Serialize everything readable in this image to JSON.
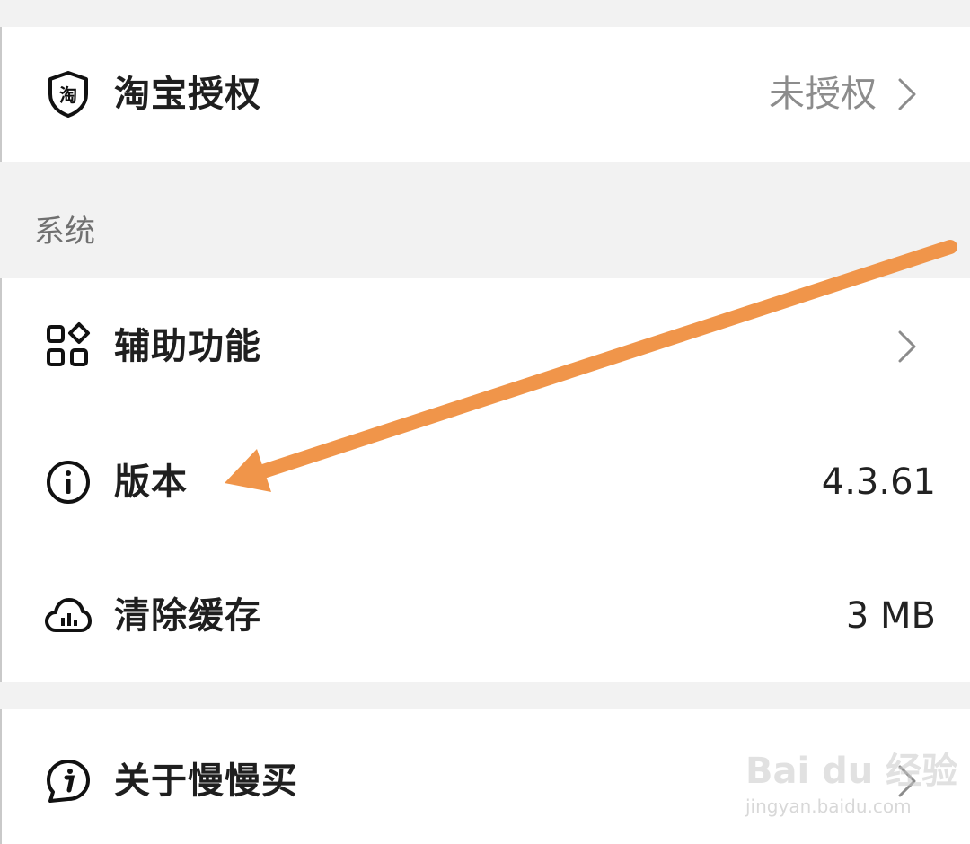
{
  "taobao_row": {
    "icon": "taobao-shield-icon",
    "icon_text": "淘",
    "label": "淘宝授权",
    "value": "未授权"
  },
  "system_section": {
    "header": "系统",
    "items": [
      {
        "icon": "apps-grid-icon",
        "label": "辅助功能",
        "value": ""
      },
      {
        "icon": "info-circle-icon",
        "label": "版本",
        "value": "4.3.61"
      },
      {
        "icon": "cloud-icon",
        "label": "清除缓存",
        "value": "3 MB"
      }
    ]
  },
  "about_row": {
    "icon": "info-bubble-icon",
    "label": "关于慢慢买"
  },
  "annotation": {
    "arrow_color": "#f0954a"
  },
  "watermark": {
    "brand": "Bai du 经验",
    "url": "jingyan.baidu.com"
  }
}
